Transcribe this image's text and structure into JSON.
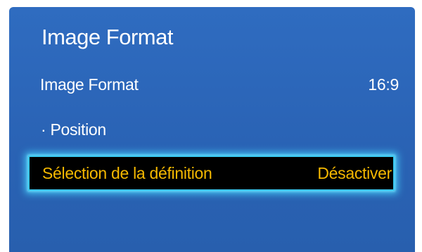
{
  "panel": {
    "title": "Image Format",
    "background_color": "#2a63b5",
    "highlight_color": "#f5b800",
    "focus_glow_color": "#39c8f0"
  },
  "menu": {
    "items": [
      {
        "label": "Image Format",
        "value": "16:9",
        "selected": false
      },
      {
        "label": "· Position",
        "value": "",
        "selected": false
      },
      {
        "label": "Sélection de la définition",
        "value": "Désactiver",
        "selected": true
      }
    ]
  }
}
